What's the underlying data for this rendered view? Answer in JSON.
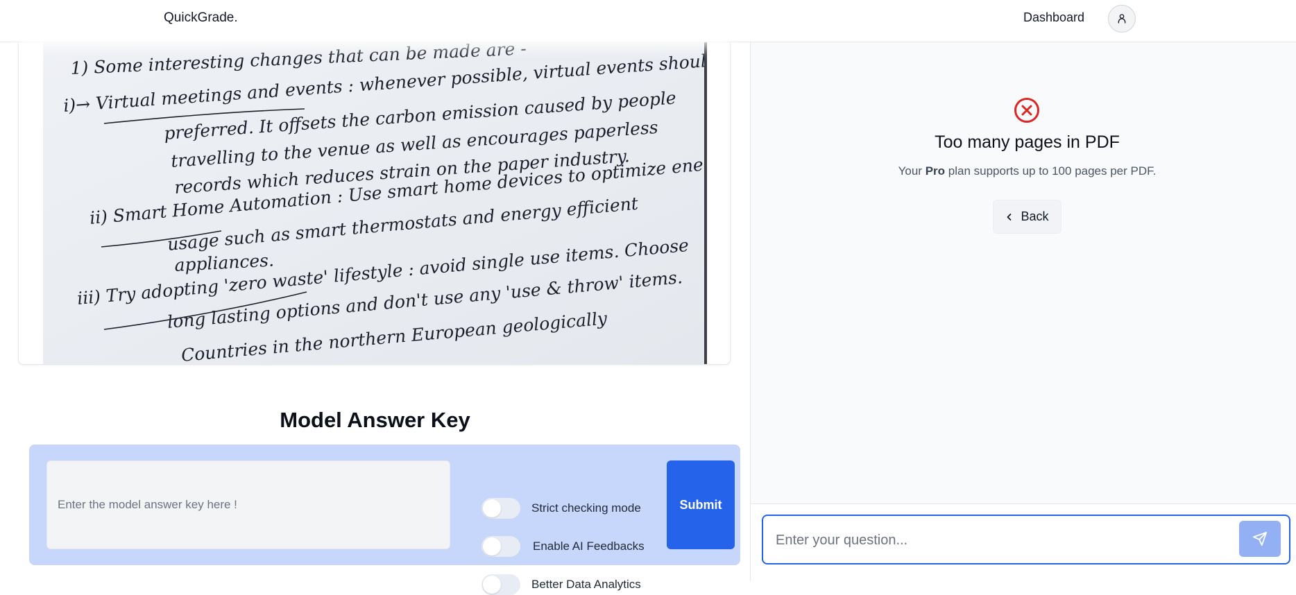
{
  "header": {
    "brand": "QuickGrade.",
    "nav_dashboard": "Dashboard",
    "avatar_icon": "user-icon"
  },
  "viewer": {
    "scanned_text": [
      "1) Some interesting changes that can be made are -",
      "i)→ Virtual meetings and events : whenever possible, virtual events should be",
      "preferred. It offsets the carbon emission caused by people",
      "travelling to the venue as well as encourages paperless",
      "records which reduces strain on the paper industry.",
      "ii) Smart Home Automation : Use smart home devices to optimize energy",
      "usage such as smart thermostats and energy efficient",
      "appliances.",
      "iii) Try adopting 'zero waste' lifestyle : avoid single use items. Choose",
      "long lasting options and don't use any 'use & throw' items.",
      "Countries in the northern European geologically"
    ]
  },
  "answer_key": {
    "title": "Model Answer Key",
    "placeholder": "Enter the model answer key here !",
    "toggles": [
      {
        "label": "Strict checking mode",
        "on": false
      },
      {
        "label": "Enable AI Feedbacks",
        "on": false
      },
      {
        "label": "Better Data Analytics",
        "on": false
      }
    ],
    "submit_label": "Submit"
  },
  "result": {
    "icon": "x-circle-icon",
    "title": "Too many pages in PDF",
    "sub_prefix": "Your",
    "sub_plan": "Pro",
    "sub_suffix": "plan supports up to 100 pages per PDF.",
    "back_label": "Back",
    "back_icon": "chevron-left-icon"
  },
  "chat": {
    "placeholder": "Enter your question...",
    "send_icon": "send-icon"
  },
  "colors": {
    "accent": "#2563eb",
    "panel_bg": "#c7d6fb",
    "error": "#dc2626",
    "send_disabled": "#93b0f5"
  }
}
